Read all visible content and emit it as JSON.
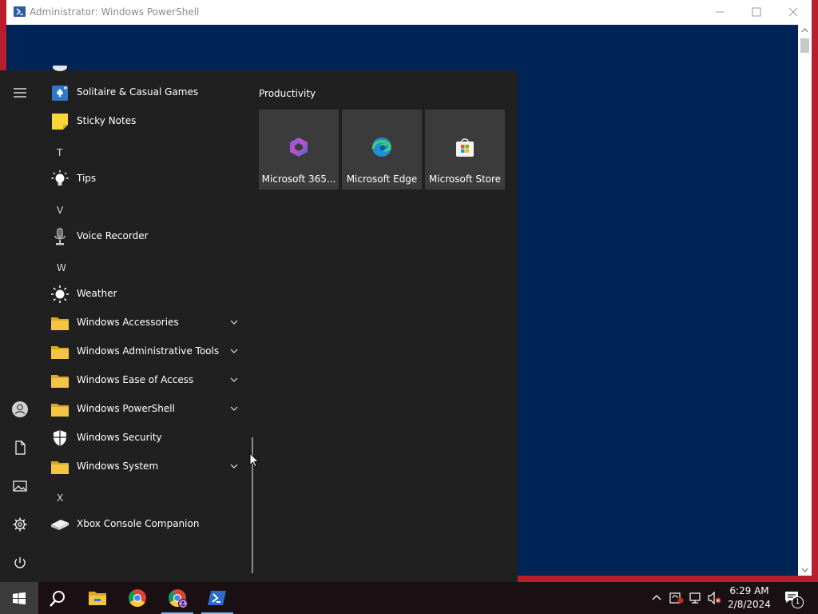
{
  "window": {
    "title": "Administrator: Windows PowerShell"
  },
  "start_menu": {
    "app_list": [
      {
        "type": "app",
        "label": "Solitaire & Casual Games",
        "icon": "solitaire-icon"
      },
      {
        "type": "app",
        "label": "Sticky Notes",
        "icon": "sticky-notes-icon"
      },
      {
        "type": "letter",
        "label": "T"
      },
      {
        "type": "app",
        "label": "Tips",
        "icon": "tips-icon"
      },
      {
        "type": "letter",
        "label": "V"
      },
      {
        "type": "app",
        "label": "Voice Recorder",
        "icon": "voice-recorder-icon"
      },
      {
        "type": "letter",
        "label": "W"
      },
      {
        "type": "app",
        "label": "Weather",
        "icon": "weather-icon"
      },
      {
        "type": "folder",
        "label": "Windows Accessories",
        "icon": "folder-icon"
      },
      {
        "type": "folder",
        "label": "Windows Administrative Tools",
        "icon": "folder-icon"
      },
      {
        "type": "folder",
        "label": "Windows Ease of Access",
        "icon": "folder-icon"
      },
      {
        "type": "folder",
        "label": "Windows PowerShell",
        "icon": "folder-icon"
      },
      {
        "type": "app",
        "label": "Windows Security",
        "icon": "shield-icon"
      },
      {
        "type": "folder",
        "label": "Windows System",
        "icon": "folder-icon"
      },
      {
        "type": "letter",
        "label": "X"
      },
      {
        "type": "app",
        "label": "Xbox Console Companion",
        "icon": "xbox-console-icon"
      }
    ],
    "tiles_group": {
      "title": "Productivity",
      "tiles": [
        {
          "label": "Microsoft 365...",
          "icon": "microsoft-365-icon"
        },
        {
          "label": "Microsoft Edge",
          "icon": "edge-icon"
        },
        {
          "label": "Microsoft Store",
          "icon": "store-icon"
        }
      ]
    },
    "rail": [
      "hamburger-menu-icon",
      "user-icon",
      "documents-icon",
      "pictures-icon",
      "settings-gear-icon",
      "power-icon"
    ]
  },
  "taskbar": {
    "pinned": [
      "search-icon",
      "file-explorer-icon",
      "chrome-icon",
      "chrome-profile-icon",
      "powershell-icon"
    ],
    "clock": {
      "time": "6:29 AM",
      "date": "2/8/2024"
    },
    "notification_count": "1"
  },
  "colors": {
    "desktop_background": "#b81e2c",
    "powershell_background": "#012456",
    "start_menu_background": "#202020",
    "tile_background": "#3b3b3b",
    "taskbar_background": "#1a0f12",
    "folder_yellow": "#f4c542"
  }
}
